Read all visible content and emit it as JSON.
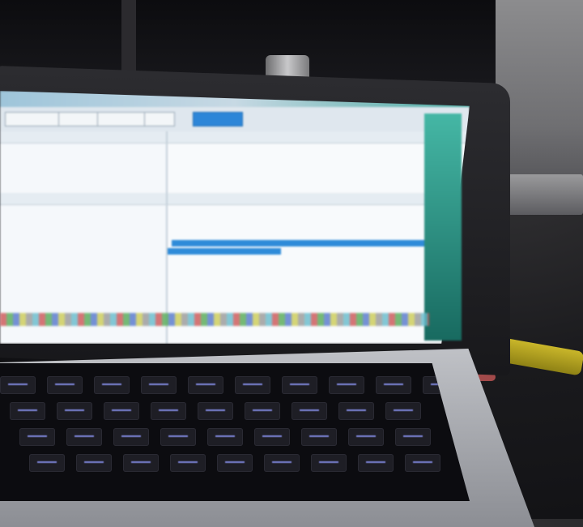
{
  "scene": {
    "description_tags": [
      "laptop",
      "screen",
      "keyboard"
    ],
    "accent_colors": {
      "screen_bg": "#eef2f6",
      "selection_blue": "#2e8bd9",
      "teal_panel": "#45b7a5",
      "key_backlight": "#7f86d9"
    }
  },
  "screen": {
    "menu_items": [
      "",
      "",
      "",
      ""
    ],
    "toolbar_buttons": [
      "",
      "",
      "",
      "",
      ""
    ],
    "left_headers": [
      "",
      ""
    ],
    "right_headers": [
      "",
      "",
      "",
      "",
      ""
    ],
    "left_rows": [
      "",
      "",
      "",
      "",
      "",
      "",
      "",
      "",
      ""
    ],
    "right_rows": [
      "",
      "",
      "",
      "",
      "",
      ""
    ]
  },
  "icons": [
    "app-window-icon",
    "laptop-icon"
  ]
}
